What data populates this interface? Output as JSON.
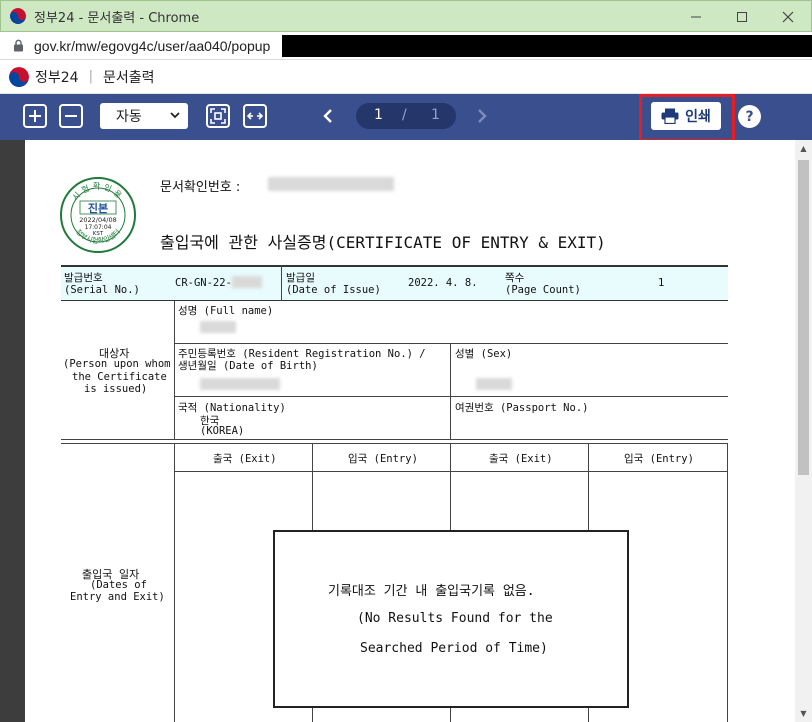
{
  "window": {
    "title": "정부24 - 문서출력 - Chrome",
    "url": "gov.kr/mw/egovg4c/user/aa040/popup"
  },
  "app": {
    "brand": "정부24",
    "separator": "|",
    "page_name": "문서출력"
  },
  "toolbar": {
    "zoom_value": "자동",
    "current_page": "1",
    "page_sep": "/",
    "total_pages": "1",
    "print_label": "인쇄",
    "help_label": "?"
  },
  "document": {
    "doc_number_label": "문서확인번호 :",
    "title": "출입국에 관한 사실증명(CERTIFICATE OF ENTRY & EXIT)",
    "stamp": {
      "top": "시험확인용",
      "main": "진본",
      "date": "2022/04/08",
      "time": "17:07:04",
      "tz": "KST",
      "bottom": "정부시험확인센터"
    },
    "serial_label": "발급번호",
    "serial_label_en": "(Serial No.)",
    "serial_value": "CR-GN-22-",
    "issue_label": "발급일",
    "issue_label_en": "(Date of Issue)",
    "issue_value": "2022. 4. 8.",
    "page_count_label": "쪽수",
    "page_count_label_en": "(Page Count)",
    "page_count_value": "1",
    "subject_label": "대상자",
    "subject_label_en_1": "(Person upon whom",
    "subject_label_en_2": "the Certificate",
    "subject_label_en_3": "is issued)",
    "full_name_label": "성명 (Full name)",
    "rrn_label_1": "주민등록번호 (Resident Registration No.) /",
    "rrn_label_2": "생년월일 (Date of Birth)",
    "sex_label": "성별 (Sex)",
    "nationality_label": "국적 (Nationality)",
    "nationality_value": "한국",
    "nationality_value_en": "(KOREA)",
    "passport_label": "여권번호 (Passport No.)",
    "dates_label": "출입국 일자",
    "dates_label_en_1": "(Dates of",
    "dates_label_en_2": "Entry and Exit)",
    "col_headers": [
      "출국 (Exit)",
      "입국 (Entry)",
      "출국 (Exit)",
      "입국 (Entry)"
    ],
    "no_result_kr": "기록대조 기간 내 출입국기록 없음.",
    "no_result_en_1": "(No Results Found for the",
    "no_result_en_2": "Searched Period of Time)"
  },
  "colors": {
    "toolbar_bg": "#3a4f8e",
    "highlight": "#e41e26",
    "titlebar_bg": "#cfe8c4",
    "table_header_bg": "#e8fbfd",
    "stamp_green": "#1f7a3a"
  }
}
